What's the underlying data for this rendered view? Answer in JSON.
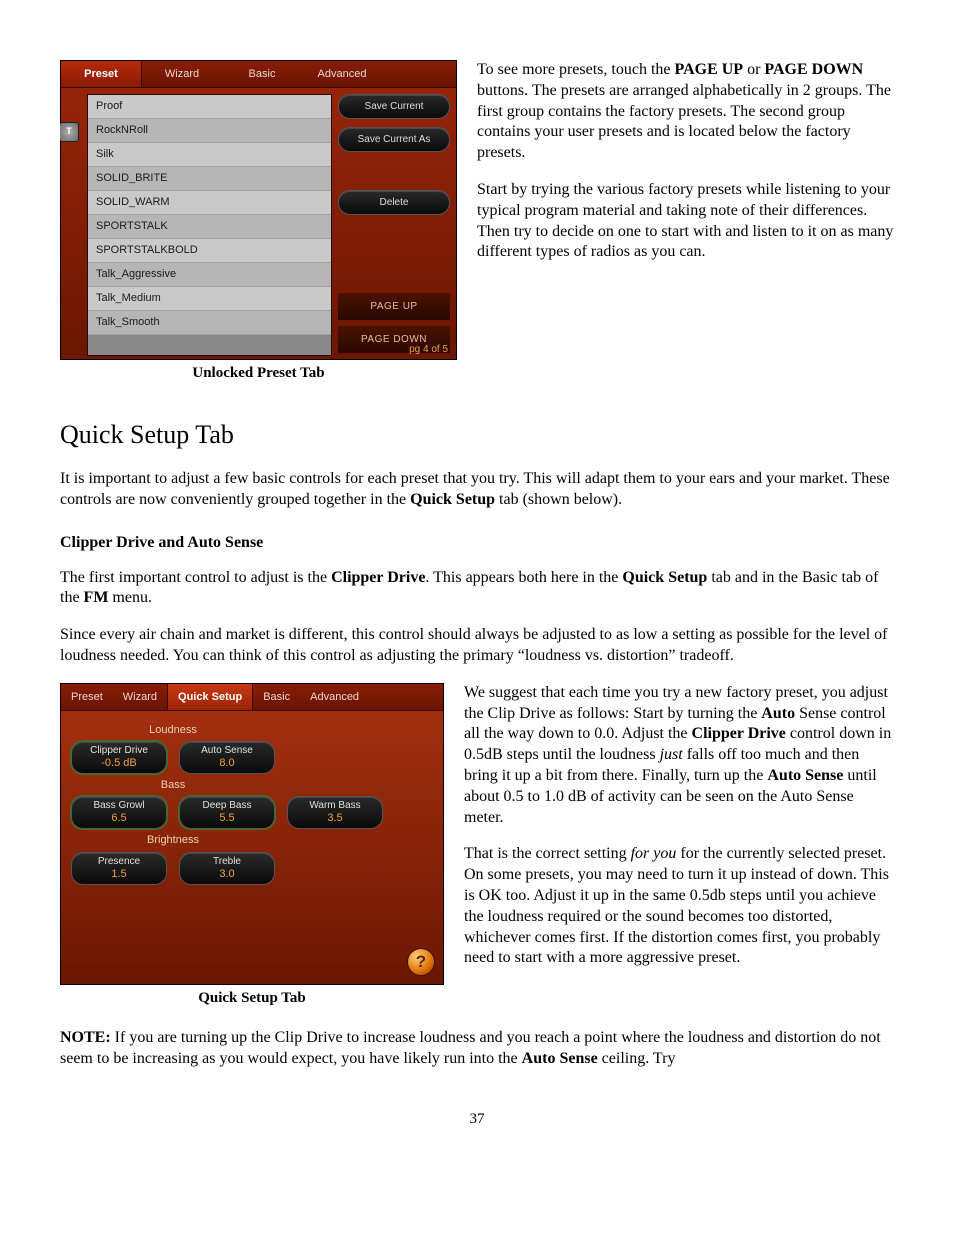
{
  "screenshot1": {
    "tabs": [
      "Preset",
      "Wizard",
      "Basic",
      "Advanced"
    ],
    "active_tab_index": 0,
    "lock_glyph": "T",
    "presets": [
      "Proof",
      "RockNRoll",
      "Silk",
      "SOLID_BRITE",
      "SOLID_WARM",
      "SPORTSTALK",
      "SPORTSTALKBOLD",
      "Talk_Aggressive",
      "Talk_Medium",
      "Talk_Smooth"
    ],
    "buttons": {
      "save_current": "Save Current",
      "save_current_as": "Save Current As",
      "delete": "Delete",
      "page_up": "PAGE UP",
      "page_down": "PAGE DOWN"
    },
    "page_info": "pg 4 of 5",
    "caption": "Unlocked Preset Tab"
  },
  "para1_a": "To see more presets, touch the ",
  "para1_bold1": "PAGE UP",
  "para1_b": " or ",
  "para1_bold2": "PAGE DOWN",
  "para1_c": " buttons. The presets are arranged alphabetically in 2 groups. The first group contains the factory presets. The second group contains your user presets and is located below the factory presets.",
  "para2": "Start by trying the various factory presets while listening to your typical program material and taking note of their differences. Then try to decide on one to start with and listen to it on as many different types of radios as you can.",
  "heading_quick_setup": "Quick Setup Tab",
  "para3_a": "It is important to adjust a few basic controls for each preset that you try. This will adapt them to your ears and your market. These controls are now conveniently grouped together in the ",
  "para3_bold1": "Quick Setup",
  "para3_b": " tab (shown below).",
  "subhead_clipper": "Clipper Drive and Auto Sense",
  "para4_a": "The first important control to adjust is the ",
  "para4_bold1": "Clipper Drive",
  "para4_b": ". This appears both here in the ",
  "para4_bold2": "Quick Setup",
  "para4_c": " tab and in the Basic tab of the ",
  "para4_bold3": "FM",
  "para4_d": " menu.",
  "para5": "Since every air chain and market is different, this control should always be adjusted to as low a setting as possible for the level of loudness needed. You can think of this control as adjusting the primary “loudness vs. distortion” tradeoff.",
  "screenshot2": {
    "tabs": [
      "Preset",
      "Wizard",
      "Quick Setup",
      "Basic",
      "Advanced"
    ],
    "active_tab_index": 2,
    "groups": [
      {
        "label": "Loudness",
        "knobs": [
          {
            "label": "Clipper Drive",
            "value": "-0.5 dB"
          },
          {
            "label": "Auto Sense",
            "value": "8.0"
          }
        ]
      },
      {
        "label": "Bass",
        "knobs": [
          {
            "label": "Bass Growl",
            "value": "6.5"
          },
          {
            "label": "Deep Bass",
            "value": "5.5"
          },
          {
            "label": "Warm Bass",
            "value": "3.5"
          }
        ]
      },
      {
        "label": "Brightness",
        "knobs": [
          {
            "label": "Presence",
            "value": "1.5"
          },
          {
            "label": "Treble",
            "value": "3.0"
          }
        ]
      }
    ],
    "help_glyph": "?",
    "caption": "Quick Setup Tab"
  },
  "para6_a": "We suggest that each time you try a new factory preset, you adjust the Clip Drive as follows: Start by turning the ",
  "para6_bold1": "Auto",
  "para6_b": " Sense control all the way down to 0.0. Adjust the ",
  "para6_bold2": "Clipper Drive",
  "para6_c": " control down in 0.5dB steps until the loudness ",
  "para6_ital1": "just",
  "para6_d": " falls off too much and then bring it up a bit from there. Finally, turn up the ",
  "para6_bold3": "Auto Sense",
  "para6_e": " until about 0.5 to 1.0 dB of activity can be seen on the Auto Sense meter.",
  "para7_a": "That is the correct setting ",
  "para7_ital1": "for you",
  "para7_b": " for the currently selected preset. On some presets, you may need to turn it up instead of down. This is OK too. Adjust it up in the same 0.5db steps until you achieve the loudness required or the sound becomes too distorted, whichever comes first. If the distortion comes first, you probably need to start with a more aggressive preset.",
  "note_label": "NOTE:",
  "note_a": " If you are turning up the Clip Drive to increase loudness and you reach a point where the loudness and distortion do not seem to be increasing as you would expect, you have likely run into the ",
  "note_bold1": "Auto Sense",
  "note_b": " ceiling. Try",
  "page_number": "37"
}
